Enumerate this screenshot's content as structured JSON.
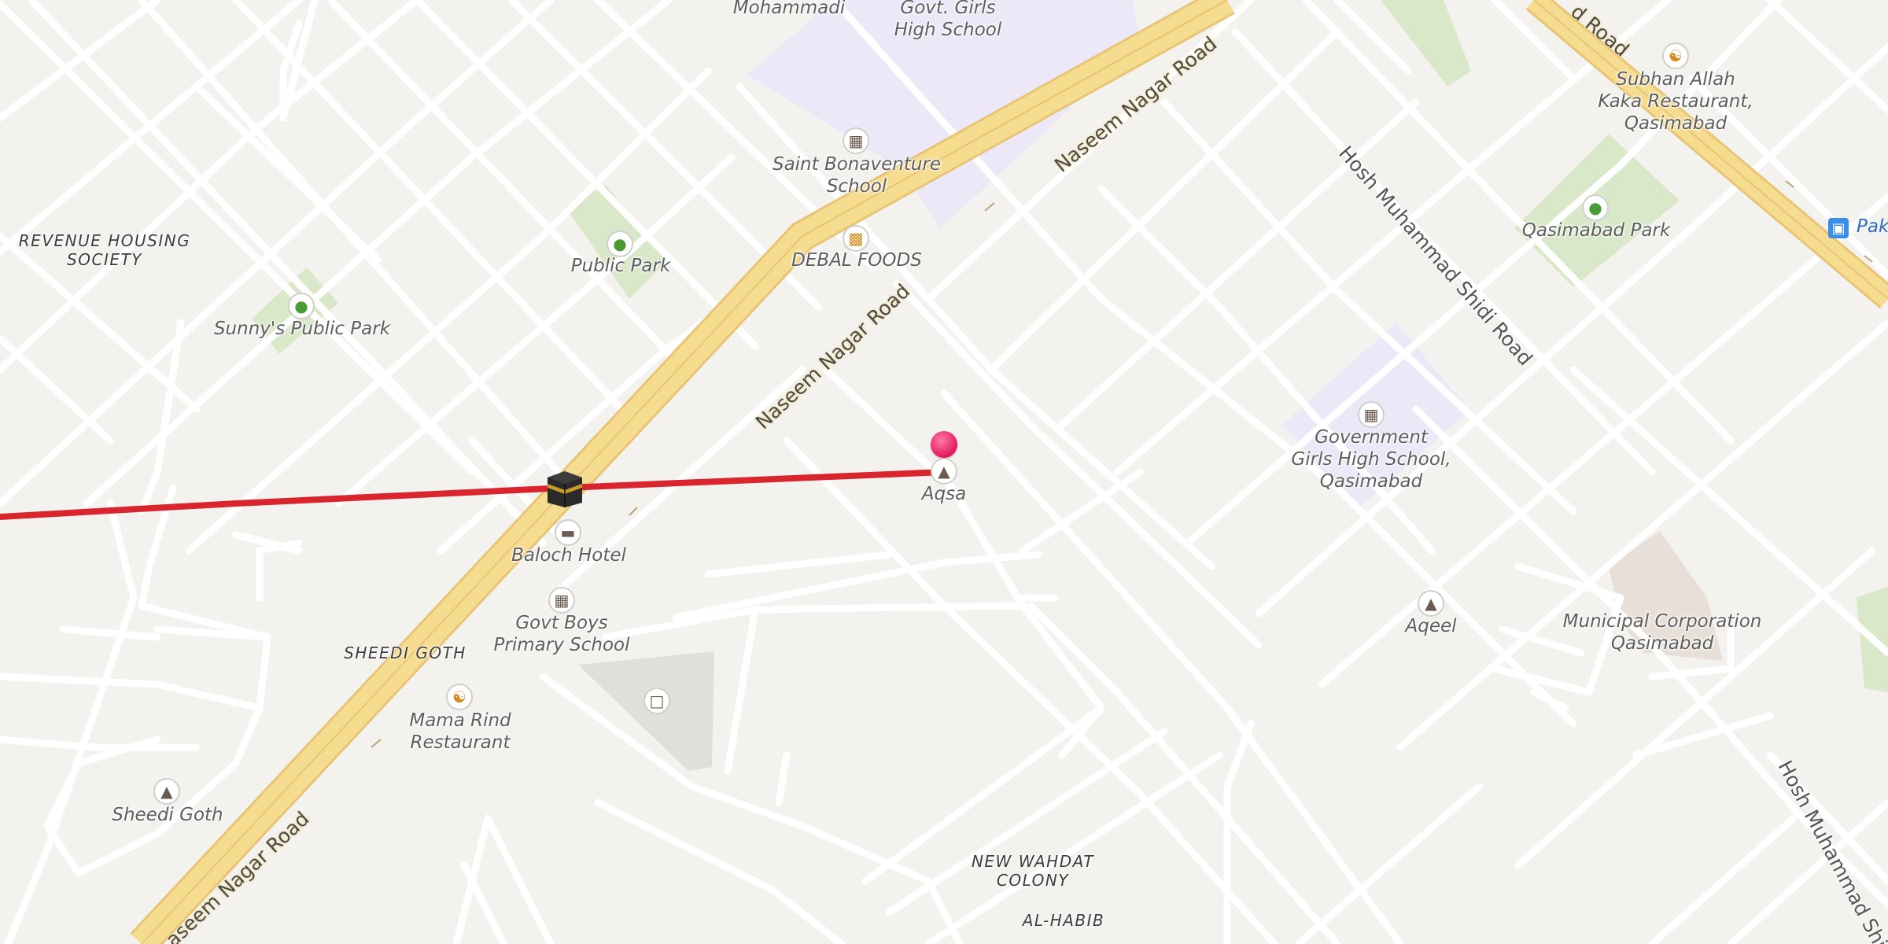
{
  "map": {
    "colors": {
      "background": "#f4f2ef",
      "street": "#ffffff",
      "arterial": "#f6dc8e",
      "route_line": "#d9262e",
      "park": "#d9e8c8",
      "school": "#ece8f7"
    },
    "roads": {
      "naseem_top": "Naseem Nagar Road",
      "naseem_mid": "Naseem Nagar Road",
      "naseem_bottom": "aseem Nagar Road",
      "hosh_top": "Hosh Muhammad Shidi Road",
      "hosh_bottom": "Hosh Muhammad Shid",
      "corner_road": "d Road"
    },
    "areas": {
      "revenue": "REVENUE HOUSING\nSOCIETY",
      "sheedi": "SHEEDI GOTH",
      "wahdat": "NEW WAHDAT\nCOLONY",
      "habib": "AL-HABIB"
    },
    "places": {
      "mohammadi": "Mohammadi",
      "govt_girls": "Govt. Girls\nHigh School",
      "saint": "Saint Bonaventure\nSchool",
      "debal": "DEBAL FOODS",
      "public_park": "Public Park",
      "sunny": "Sunny's Public Park",
      "aqsa": "Aqsa",
      "baloch": "Baloch Hotel",
      "govt_boys": "Govt Boys\nPrimary School",
      "mama": "Mama Rind\nRestaurant",
      "sheedi_goth": "Sheedi Goth",
      "government_girls": "Government\nGirls High School,\nQasimabad",
      "aqeel": "Aqeel",
      "municipal": "Municipal Corporation\nQasimabad",
      "qasimabad_park": "Qasimabad Park",
      "subhan": "Subhan Allah\nKaka Restaurant,\nQasimabad",
      "bus_stop": "Pak"
    },
    "icons": {
      "school": "school-icon",
      "tree": "tree-icon",
      "food": "restaurant-icon",
      "burger": "fastfood-icon",
      "mosque": "mosque-icon",
      "hotel": "hotel-icon",
      "bin": "waste-icon",
      "kaaba": "kaaba-icon",
      "pin": "location-pin-icon",
      "bus": "bus-stop-icon"
    }
  }
}
